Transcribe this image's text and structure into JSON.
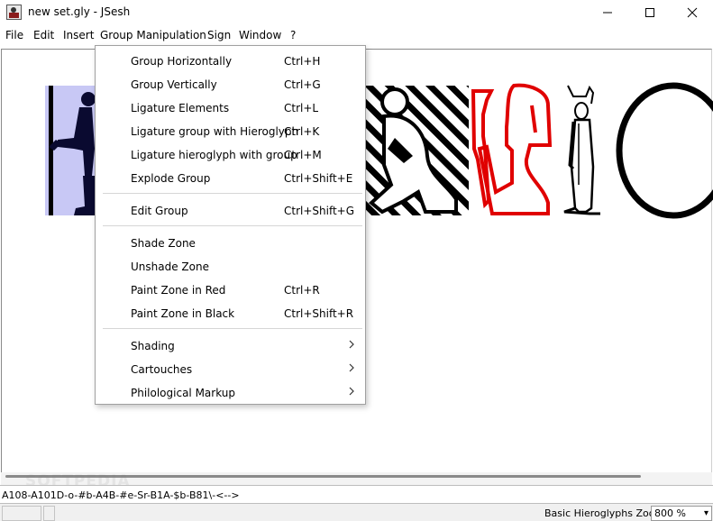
{
  "window": {
    "title": "new set.gly - JSesh"
  },
  "menubar": {
    "items": [
      {
        "label": "File"
      },
      {
        "label": "Edit"
      },
      {
        "label": "Insert"
      },
      {
        "label": "Group Manipulation"
      },
      {
        "label": "Sign"
      },
      {
        "label": "Window"
      },
      {
        "label": "?"
      }
    ]
  },
  "dropdown": {
    "groups": [
      [
        {
          "label": "Group Horizontally",
          "shortcut": "Ctrl+H"
        },
        {
          "label": "Group Vertically",
          "shortcut": "Ctrl+G"
        },
        {
          "label": "Ligature Elements",
          "shortcut": "Ctrl+L"
        },
        {
          "label": "Ligature group with Hieroglyph",
          "shortcut": "Ctrl+K"
        },
        {
          "label": "Ligature hieroglyph with group",
          "shortcut": "Ctrl+M"
        },
        {
          "label": "Explode Group",
          "shortcut": "Ctrl+Shift+E"
        }
      ],
      [
        {
          "label": "Edit Group",
          "shortcut": "Ctrl+Shift+G"
        }
      ],
      [
        {
          "label": "Shade Zone",
          "shortcut": ""
        },
        {
          "label": "Unshade Zone",
          "shortcut": ""
        },
        {
          "label": "Paint Zone in Red",
          "shortcut": "Ctrl+R"
        },
        {
          "label": "Paint Zone in Black",
          "shortcut": "Ctrl+Shift+R"
        }
      ],
      [
        {
          "label": "Shading",
          "submenu": true
        },
        {
          "label": "Cartouches",
          "submenu": true
        },
        {
          "label": "Philological Markup",
          "submenu": true
        }
      ]
    ]
  },
  "codeline": {
    "value": "A108-A101D-o-#b-A4B-#e-Sr-B1A-$b-B81\\-<-->"
  },
  "statusbar": {
    "font_label": "Basic Hieroglyphs Zoom",
    "zoom": "800 %"
  },
  "watermark": "SOFTPEDIA",
  "colors": {
    "selection": "#c8c8f5",
    "red_glyph": "#e00000",
    "black": "#000000"
  }
}
